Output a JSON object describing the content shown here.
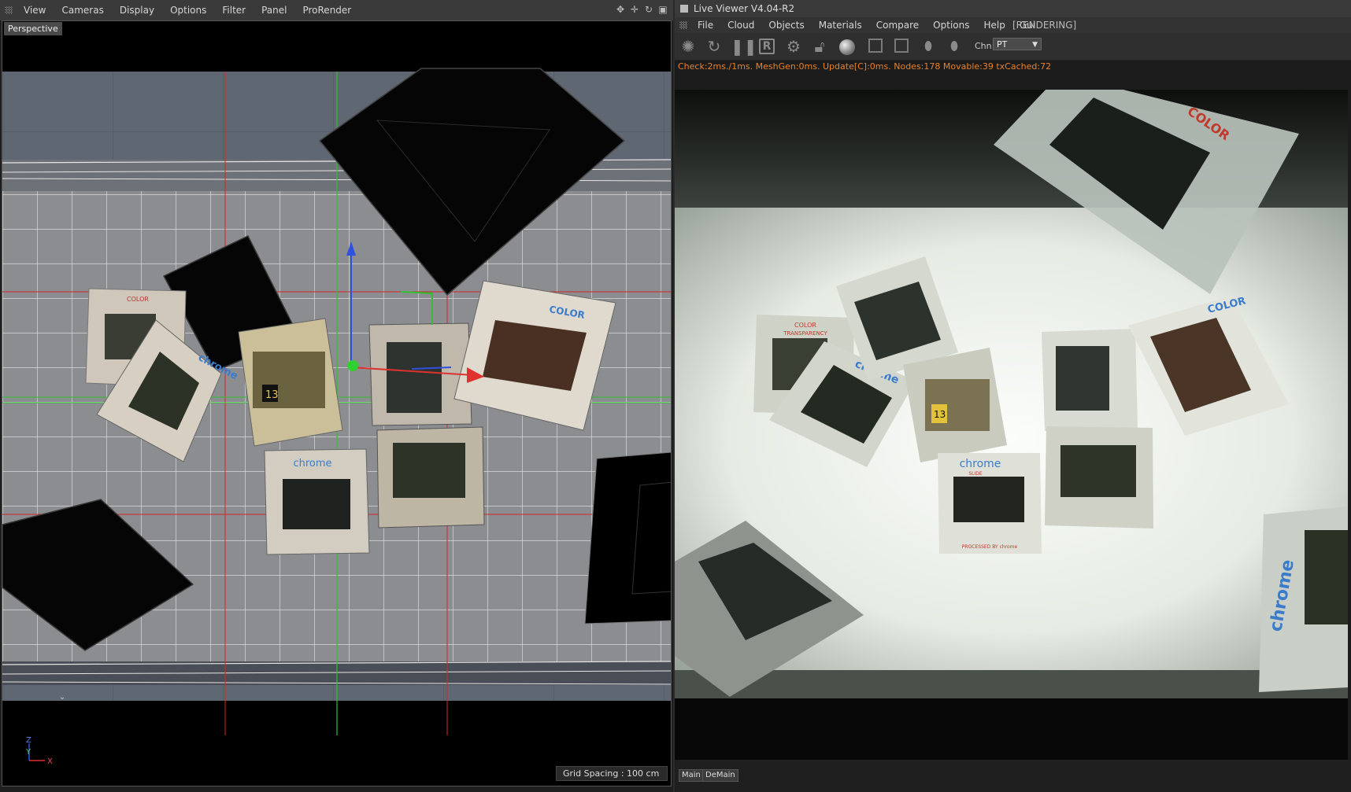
{
  "viewport_panel": {
    "menu": [
      "View",
      "Cameras",
      "Display",
      "Options",
      "Filter",
      "Panel",
      "ProRender"
    ],
    "nav_icons": [
      "move-icon",
      "zoom-icon",
      "rotate-icon",
      "maximize-icon"
    ],
    "camera_label": "Perspective",
    "grid_spacing": "Grid Spacing : 100 cm",
    "axis_labels": {
      "z": "Z",
      "y": "Y",
      "x": "X"
    }
  },
  "live_viewer": {
    "title": "Live Viewer V4.04-R2",
    "menu": [
      "File",
      "Cloud",
      "Objects",
      "Materials",
      "Compare",
      "Options",
      "Help",
      "Gui"
    ],
    "status": "[RENDERING]",
    "toolbar_icons": [
      "restart-icon",
      "refresh-icon",
      "pause-icon",
      "region-render-icon",
      "settings-icon",
      "lock-icon",
      "material-ball-icon",
      "frame-icon",
      "frame-compare-icon",
      "focus-pick-icon",
      "material-pick-icon"
    ],
    "channel_label": "Chn:",
    "channel_value": "PT",
    "stats": "Check:2ms./1ms. MeshGen:0ms. Update[C]:0ms. Nodes:178 Movable:39 txCached:72",
    "bottom_tabs": [
      "Main",
      "DeMain"
    ]
  },
  "slides": {
    "color_text": "COLOR",
    "transparency_text": "TRANSPARENCY",
    "chrome_text": "chrome",
    "slide_text": "SLIDE",
    "processed_text": "PROCESSED BY chrome",
    "number_tag": "13"
  },
  "colors": {
    "viewport_floor": "#8a8c90",
    "render_background": "#e8ebe6",
    "stats_text": "#e8822a",
    "axis_x": "#e03030",
    "axis_y": "#30c030",
    "axis_z": "#3050e0",
    "slide_blue": "#3a7ccc",
    "slide_red": "#c0392b"
  }
}
